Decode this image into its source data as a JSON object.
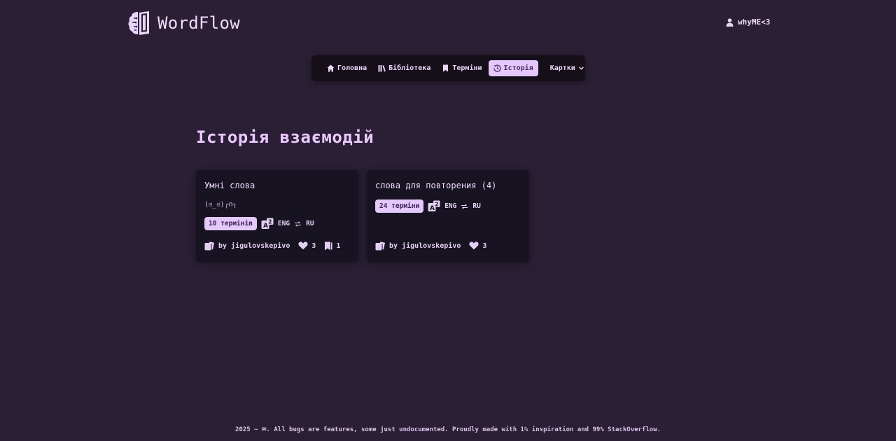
{
  "header": {
    "app_name": "WordFlow",
    "user_name": "whyME<3"
  },
  "nav": {
    "home": "Головна",
    "library": "Бібліотека",
    "terms": "Терміни",
    "history": "Історія",
    "cards": "Картки"
  },
  "main": {
    "title": "Історія взаємодій"
  },
  "cards": [
    {
      "title": "Умні слова",
      "description": "(ಠ_ಠ)┌∩┐",
      "terms": "10 термінів",
      "lang_from": "ENG",
      "lang_to": "RU",
      "author": "by jigulovskepivo",
      "likes": "3",
      "saves": "1"
    },
    {
      "title": "слова для повторения (4)",
      "terms": "24 терміни",
      "lang_from": "ENG",
      "lang_to": "RU",
      "author": "by jigulovskepivo",
      "likes": "3"
    }
  ],
  "footer": {
    "year": "2025 ~",
    "text": ". All bugs are features, some just undocumented. Proudly made with 1% inspiration and 99% StackOverflow."
  },
  "colors": {
    "background": "#2a1f34",
    "surface": "#181320",
    "accent": "#e4c7fb",
    "heading": "#ebc9ff"
  },
  "icons": [
    "brain-book-logo-icon",
    "user-icon",
    "home-icon",
    "library-icon",
    "bookmark-icon",
    "history-icon",
    "chevron-down-icon",
    "translate-icon",
    "swap-arrows-icon",
    "cards-icon",
    "heart-icon",
    "infinity-icon"
  ]
}
